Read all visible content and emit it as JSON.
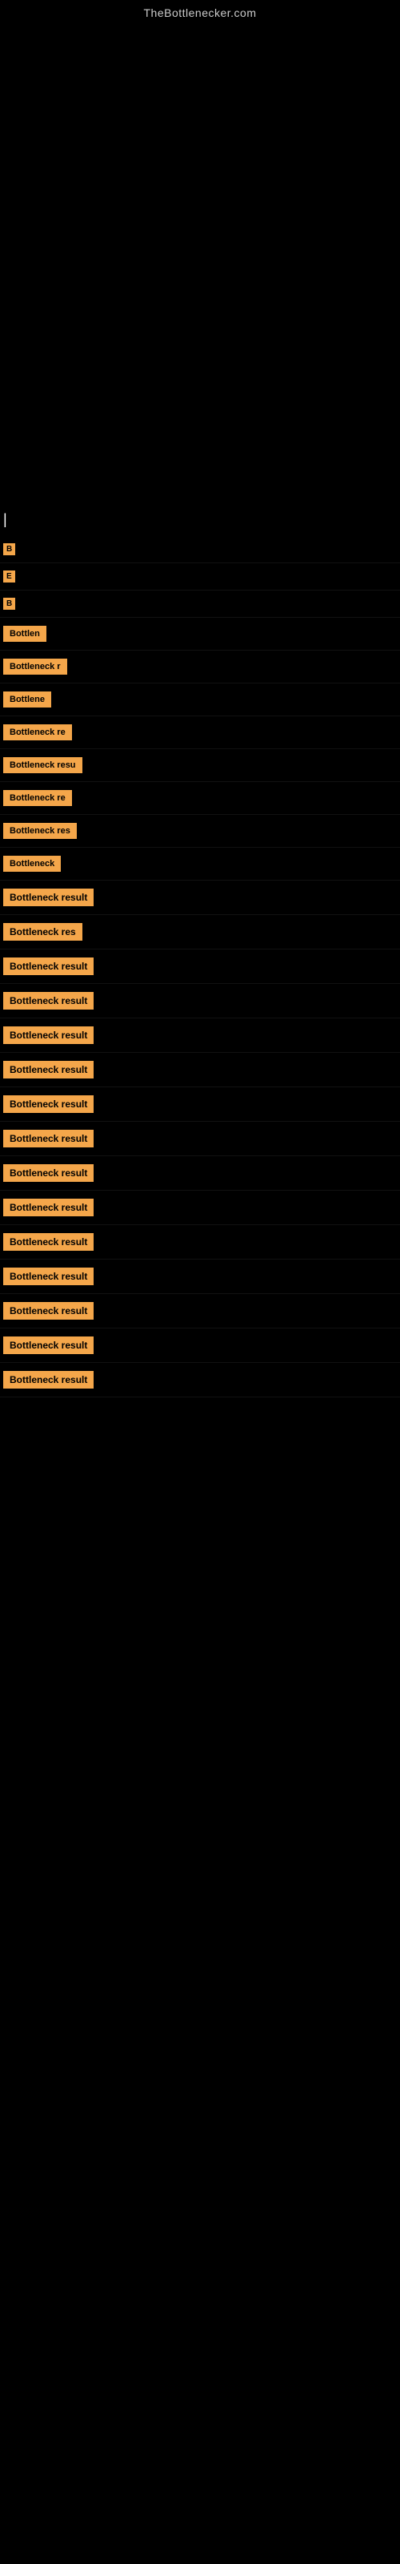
{
  "site": {
    "title": "TheBottlenecker.com"
  },
  "results": [
    {
      "id": 1,
      "label": "B",
      "size": "tiny"
    },
    {
      "id": 2,
      "label": "E",
      "size": "tiny"
    },
    {
      "id": 3,
      "label": "B",
      "size": "tiny"
    },
    {
      "id": 4,
      "label": "Bottlen",
      "size": "small"
    },
    {
      "id": 5,
      "label": "Bottleneck r",
      "size": "medium"
    },
    {
      "id": 6,
      "label": "Bottlene",
      "size": "small-med"
    },
    {
      "id": 7,
      "label": "Bottleneck re",
      "size": "medium"
    },
    {
      "id": 8,
      "label": "Bottleneck resu",
      "size": "medium-lg"
    },
    {
      "id": 9,
      "label": "Bottleneck re",
      "size": "medium"
    },
    {
      "id": 10,
      "label": "Bottleneck res",
      "size": "medium"
    },
    {
      "id": 11,
      "label": "Bottleneck",
      "size": "medium"
    },
    {
      "id": 12,
      "label": "Bottleneck result",
      "size": "large"
    },
    {
      "id": 13,
      "label": "Bottleneck res",
      "size": "medium"
    },
    {
      "id": 14,
      "label": "Bottleneck result",
      "size": "large"
    },
    {
      "id": 15,
      "label": "Bottleneck result",
      "size": "large"
    },
    {
      "id": 16,
      "label": "Bottleneck result",
      "size": "large"
    },
    {
      "id": 17,
      "label": "Bottleneck result",
      "size": "large"
    },
    {
      "id": 18,
      "label": "Bottleneck result",
      "size": "large"
    },
    {
      "id": 19,
      "label": "Bottleneck result",
      "size": "large"
    },
    {
      "id": 20,
      "label": "Bottleneck result",
      "size": "large"
    },
    {
      "id": 21,
      "label": "Bottleneck result",
      "size": "large"
    },
    {
      "id": 22,
      "label": "Bottleneck result",
      "size": "large"
    },
    {
      "id": 23,
      "label": "Bottleneck result",
      "size": "large"
    },
    {
      "id": 24,
      "label": "Bottleneck result",
      "size": "large"
    },
    {
      "id": 25,
      "label": "Bottleneck result",
      "size": "large"
    },
    {
      "id": 26,
      "label": "Bottleneck result",
      "size": "large"
    }
  ],
  "cursor": "|"
}
